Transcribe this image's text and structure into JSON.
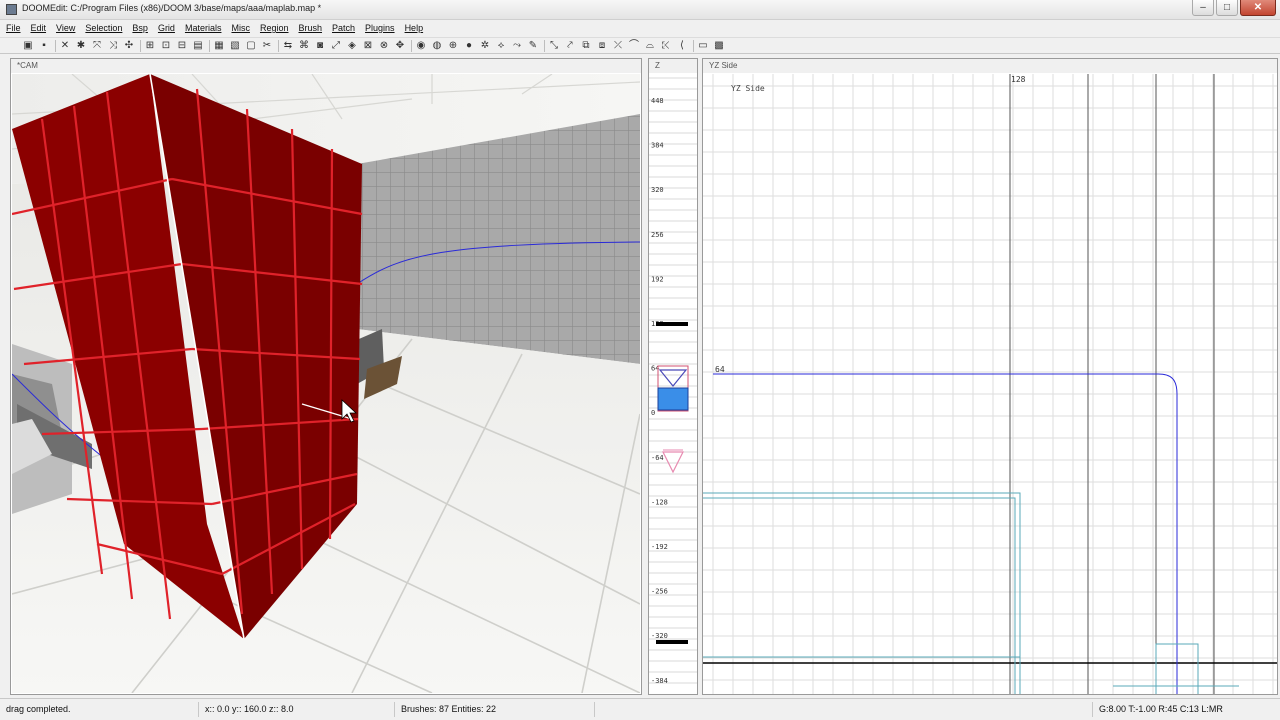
{
  "window": {
    "title": "DOOMEdit: C:/Program Files (x86)/DOOM 3/base/maps/aaa/maplab.map *",
    "controls": {
      "minimize": "–",
      "maximize": "□",
      "close": "✕"
    }
  },
  "menu": [
    "File",
    "Edit",
    "View",
    "Selection",
    "Bsp",
    "Grid",
    "Materials",
    "Misc",
    "Region",
    "Brush",
    "Patch",
    "Plugins",
    "Help"
  ],
  "toolbar": {
    "buttons": [
      {
        "icon": "open-icon",
        "glyph": "▣"
      },
      {
        "icon": "save-icon",
        "glyph": "▪"
      },
      {
        "icon": "flip-x-icon",
        "glyph": "✕"
      },
      {
        "icon": "flip-y-icon",
        "glyph": "✱"
      },
      {
        "icon": "rotate-x-icon",
        "glyph": "⤧"
      },
      {
        "icon": "rotate-y-icon",
        "glyph": "⤨"
      },
      {
        "icon": "rotate-z-icon",
        "glyph": "✣"
      },
      {
        "icon": "select-complete-tall-icon",
        "glyph": "⊞"
      },
      {
        "icon": "select-touching-icon",
        "glyph": "⊡"
      },
      {
        "icon": "select-partial-tall-icon",
        "glyph": "⊟"
      },
      {
        "icon": "select-inside-icon",
        "glyph": "▤"
      },
      {
        "icon": "csg-subtract-icon",
        "glyph": "▦"
      },
      {
        "icon": "csg-merge-icon",
        "glyph": "▧"
      },
      {
        "icon": "hollow-icon",
        "glyph": "▢"
      },
      {
        "icon": "clipper-icon",
        "glyph": "✂"
      },
      {
        "icon": "change-views-icon",
        "glyph": "⇆"
      },
      {
        "icon": "texture-lock-icon",
        "glyph": "⌘"
      },
      {
        "icon": "camera-icon",
        "glyph": "◙"
      },
      {
        "icon": "scale-icon",
        "glyph": "⤢"
      },
      {
        "icon": "entity-icon",
        "glyph": "◈"
      },
      {
        "icon": "drag-edges-icon",
        "glyph": "⊠"
      },
      {
        "icon": "drag-vertices-icon",
        "glyph": "⊗"
      },
      {
        "icon": "move-icon",
        "glyph": "✥"
      },
      {
        "icon": "patch-icon",
        "glyph": "◉"
      },
      {
        "icon": "patch-bend-icon",
        "glyph": "◍"
      },
      {
        "icon": "patch-insert-icon",
        "glyph": "⊕"
      },
      {
        "icon": "light-icon",
        "glyph": "●"
      },
      {
        "icon": "cubic-clip-icon",
        "glyph": "✲"
      },
      {
        "icon": "spline-icon",
        "glyph": "⟡"
      },
      {
        "icon": "curve-edit-icon",
        "glyph": "⤳"
      },
      {
        "icon": "pen-icon",
        "glyph": "✎"
      },
      {
        "icon": "select-mode-icon",
        "glyph": "⤡"
      },
      {
        "icon": "connect-icon",
        "glyph": "⤤"
      },
      {
        "icon": "group-icon",
        "glyph": "⧉"
      },
      {
        "icon": "stairs-icon",
        "glyph": "⧈"
      },
      {
        "icon": "path-icon",
        "glyph": "⤫"
      },
      {
        "icon": "arc-icon",
        "glyph": "⌒"
      },
      {
        "icon": "trim-icon",
        "glyph": "⌓"
      },
      {
        "icon": "sweep-icon",
        "glyph": "⤪"
      },
      {
        "icon": "back-icon",
        "glyph": "⟨"
      },
      {
        "icon": "frame-icon",
        "glyph": "▭"
      },
      {
        "icon": "render-icon",
        "glyph": "▩"
      }
    ]
  },
  "cam_view": {
    "label": "*CAM"
  },
  "z_view": {
    "label": "Z",
    "ticks": [
      "448",
      "384",
      "320",
      "256",
      "192",
      "128",
      "64",
      "0",
      "-64",
      "-128",
      "-192",
      "-256",
      "-320",
      "-384"
    ]
  },
  "yz_view": {
    "header_label": "YZ Side",
    "inner_label": "YZ Side",
    "x_label": "128",
    "y_label": "64"
  },
  "status": {
    "message": "drag completed.",
    "coords": "x:: 0.0  y:: 160.0  z:: 8.0",
    "counts": "Brushes: 87 Entities: 22",
    "grid_info": "G:8.00 T:-1.00 R:45 C:13 L:MR"
  },
  "colors": {
    "brush_red": "#8b0000",
    "brush_grid": "#e0222a",
    "selection_blue": "#2a2ad8",
    "cyan_brush": "#5aa9b8"
  }
}
